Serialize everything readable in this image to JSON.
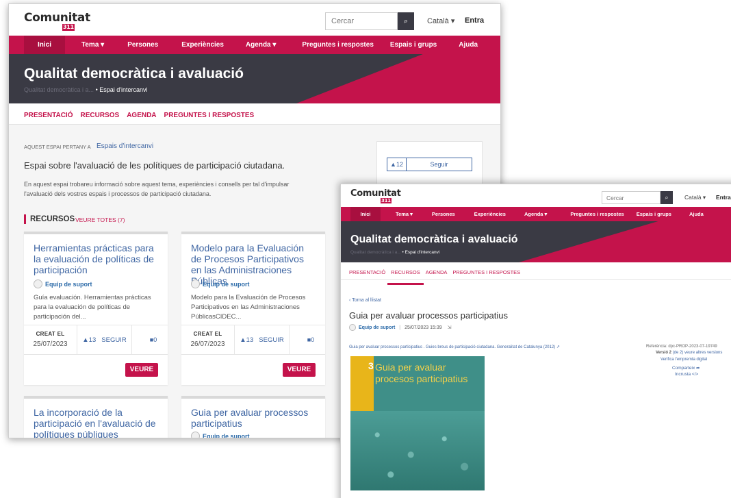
{
  "header": {
    "logo": "Comunitat",
    "logo_badge": "311",
    "search_placeholder": "Cercar",
    "search_icon": "search-icon",
    "language": "Català ▾",
    "login": "Entra"
  },
  "nav": {
    "items": [
      "Inici",
      "Tema ▾",
      "Persones",
      "Experiències",
      "Agenda ▾",
      "Preguntes i respostes",
      "Espais i grups",
      "Ajuda"
    ],
    "active": "Inici"
  },
  "hero": {
    "title": "Qualitat democràtica i avaluació",
    "breadcrumb_faint": "Qualitat democràtica i a...",
    "breadcrumb": "• Espai d'intercanvi"
  },
  "back": {
    "tabs": [
      "PRESENTACIÓ",
      "RECURSOS",
      "AGENDA",
      "PREGUNTES I RESPOSTES"
    ],
    "belongs_label": "AQUEST ESPAI PERTANY A",
    "belongs_link": "Espais d'intercanvi",
    "lead": "Espai sobre l'avaluació de les polítiques de participació ciutadana.",
    "desc_1": "En aquest espai trobareu informació sobre aquest tema, experiències i consells per tal d'impulsar",
    "desc_2": "l'avaluació dels vostres espais i processos de participació ciutadana.",
    "follow_count": "▲12",
    "follow_label": "Seguir",
    "section_title": "RECURSOS",
    "section_link": "VEURE TOTES (7)",
    "cards": [
      {
        "title": "Herramientas prácticas para la evaluación de políticas de participación",
        "author": "Equip de suport",
        "excerpt": "Guía evaluación. Herramientas prácticas para la evaluación de políticas de participación del...",
        "created_label": "CREAT EL",
        "date": "25/07/2023",
        "votes": "▲13",
        "follow": "SEGUIR",
        "comments": "■0",
        "button": "VEURE"
      },
      {
        "title": "Modelo para la Evaluación de Procesos Participativos en las Administraciones Públicas",
        "author": "Equip de suport",
        "excerpt": "Modelo para la Evaluación de Procesos Participativos en las Administraciones PúblicasCIDEC...",
        "created_label": "CREAT EL",
        "date": "26/07/2023",
        "votes": "▲13",
        "follow": "SEGUIR",
        "comments": "■0",
        "button": "VEURE"
      },
      {
        "title": "La incorporació de la participació en l'avaluació de polítiques públiques",
        "author": "",
        "excerpt": ""
      },
      {
        "title": "Guia per avaluar processos participatius",
        "author": "Equip de suport",
        "excerpt": ""
      }
    ]
  },
  "front": {
    "tabs": [
      "PRESENTACIÓ",
      "RECURSOS",
      "AGENDA",
      "PREGUNTES I RESPOSTES"
    ],
    "active_tab": "RECURSOS",
    "back_link": "‹ Torna al llistat",
    "title": "Guia per avaluar processos participatius",
    "author": "Equip de suport",
    "datetime": "25/07/2023 15:39",
    "reference_link": "Guia per avaluar processos participatius . Guies breus de participació ciutadana. Generalitat de Catalunya (2012) ↗",
    "ref_label": "Referència: dpc-PROP-2023-07-19749",
    "version_label": "Versió 2",
    "version_rest": "(de 2) veure altres versions",
    "verify": "Verifica l'empremta digital",
    "share": "Comparteix ➦",
    "embed": "Incrusta </>",
    "cover_number": "3",
    "cover_title_1": "Guia per avaluar",
    "cover_title_2": "procesos participatius"
  },
  "colors": {
    "brand": "#c4134b",
    "hero": "#3a3a44",
    "link": "#3f66a3",
    "cover_teal": "#3f8f88",
    "cover_yellow": "#e8b51a"
  }
}
